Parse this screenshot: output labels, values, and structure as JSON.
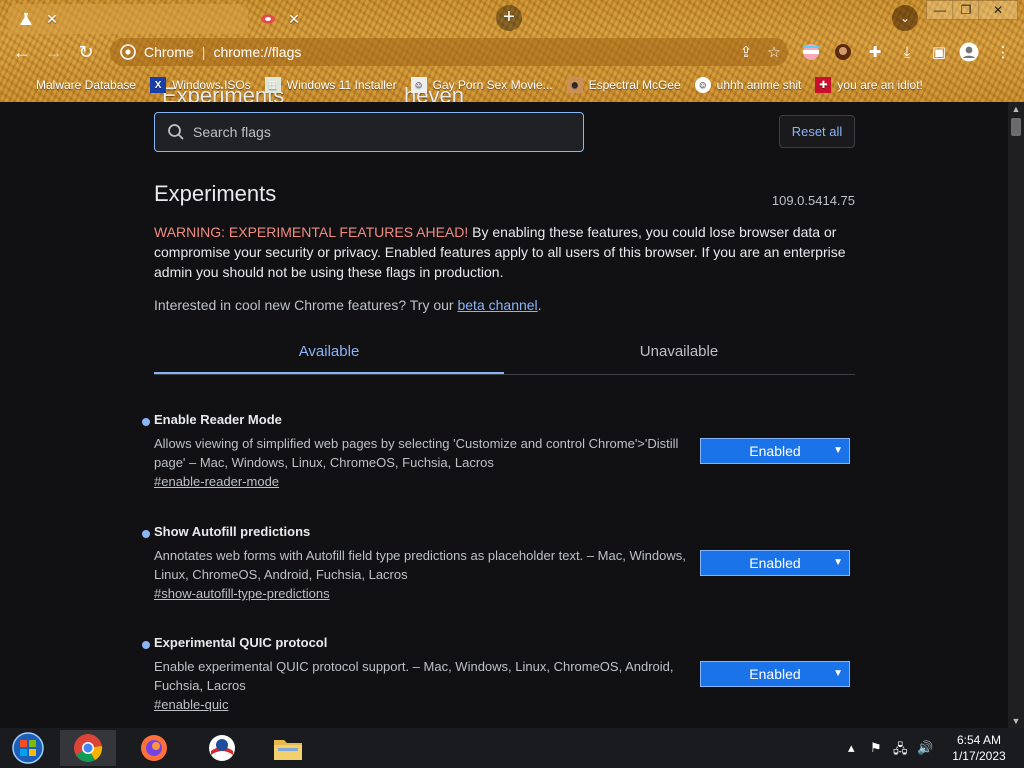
{
  "tabs": [
    {
      "title": "Experiments",
      "active": true
    },
    {
      "title": "heven",
      "active": false
    }
  ],
  "toolbar": {
    "site_label": "Chrome",
    "url": "chrome://flags"
  },
  "bookmarks": [
    {
      "label": "Malware Database"
    },
    {
      "label": "Windows ISOs"
    },
    {
      "label": "Windows 11 Installer"
    },
    {
      "label": "Gay Porn Sex Movie..."
    },
    {
      "label": "Espectral McGee"
    },
    {
      "label": "uhhh anime shit"
    },
    {
      "label": "you are an idiot!"
    }
  ],
  "page": {
    "search_placeholder": "Search flags",
    "reset_label": "Reset all",
    "title": "Experiments",
    "version": "109.0.5414.75",
    "warning_strong": "WARNING: EXPERIMENTAL FEATURES AHEAD!",
    "warning_rest": " By enabling these features, you could lose browser data or compromise your security or privacy. Enabled features apply to all users of this browser. If you are an enterprise admin you should not be using these flags in production.",
    "interest_text": "Interested in cool new Chrome features? Try our ",
    "interest_link": "beta channel",
    "interest_end": ".",
    "tab_available": "Available",
    "tab_unavailable": "Unavailable"
  },
  "flags": [
    {
      "name": "Enable Reader Mode",
      "desc": "Allows viewing of simplified web pages by selecting 'Customize and control Chrome'>'Distill page' – Mac, Windows, Linux, ChromeOS, Fuchsia, Lacros",
      "anchor": "#enable-reader-mode",
      "value": "Enabled"
    },
    {
      "name": "Show Autofill predictions",
      "desc": "Annotates web forms with Autofill field type predictions as placeholder text. – Mac, Windows, Linux, ChromeOS, Android, Fuchsia, Lacros",
      "anchor": "#show-autofill-type-predictions",
      "value": "Enabled"
    },
    {
      "name": "Experimental QUIC protocol",
      "desc": "Enable experimental QUIC protocol support. – Mac, Windows, Linux, ChromeOS, Android, Fuchsia, Lacros",
      "anchor": "#enable-quic",
      "value": "Enabled"
    }
  ],
  "taskbar": {
    "time": "6:54 AM",
    "date": "1/17/2023"
  },
  "colors": {
    "accent": "#8ab4f8",
    "warning": "#f28b82",
    "select_bg": "#1a73e8"
  }
}
